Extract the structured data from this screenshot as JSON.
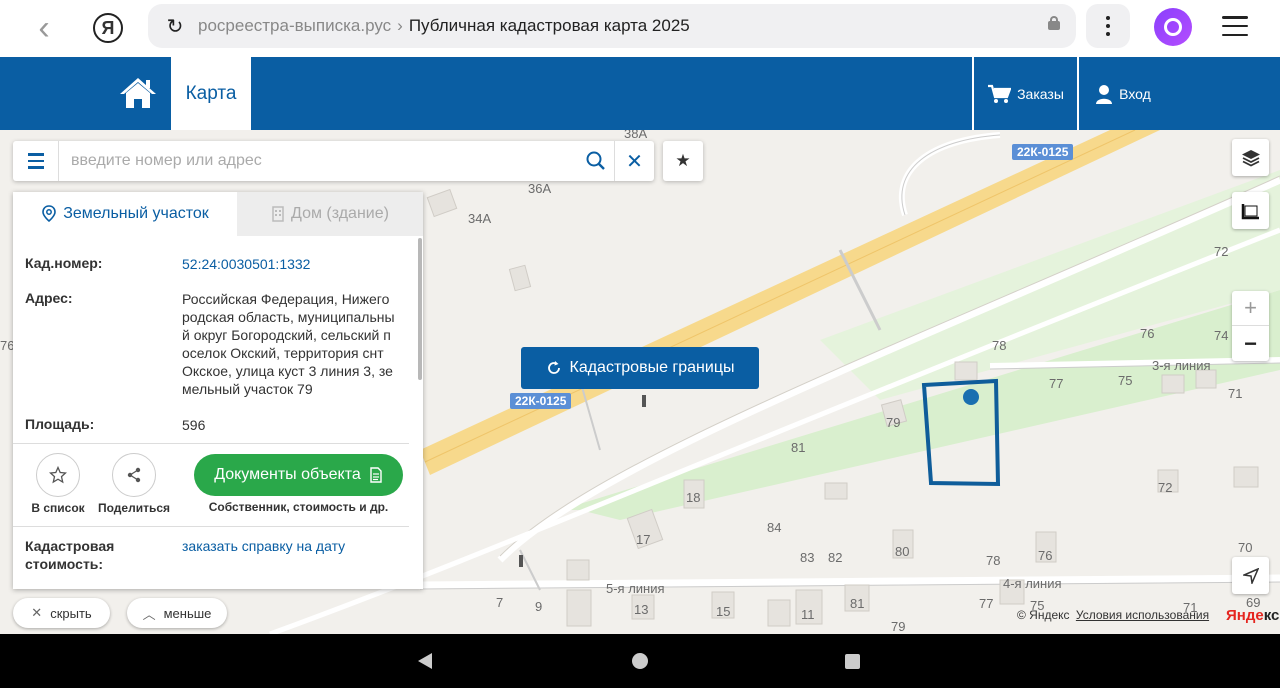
{
  "browser": {
    "domain": "росреестра-выписка.рус",
    "separator": "›",
    "page_title": "Публичная кадастровая карта 2025",
    "yandex_letter": "Я"
  },
  "header": {
    "tab_map": "Карта",
    "orders": "Заказы",
    "login": "Вход"
  },
  "search": {
    "placeholder": "введите номер или адрес"
  },
  "panel": {
    "tab_land": "Земельный участок",
    "tab_house": "Дом (здание)",
    "kad_label": "Кад.номер:",
    "kad_value": "52:24:0030501:1332",
    "address_label": "Адрес:",
    "address_value": "Российская Федерация, Нижего родская область, муниципальны й округ Богородский, сельский п оселок Окский, территория снт Окское, улица куст 3 линия 3, зе мельный участок 79",
    "area_label": "Площадь:",
    "area_value": "596",
    "add_to_list": "В список",
    "share": "Поделиться",
    "documents_button": "Документы объекта",
    "documents_sub": "Собственник, стоимость и др.",
    "cost_label": "Кадастровая стоимость:",
    "cost_link": "заказать справку на дату"
  },
  "map": {
    "cadastral_button": "Кадастровые границы",
    "road_badge": "22К-0125",
    "street_3": "3-я линия",
    "street_4": "4-я линия",
    "street_5": "5-я линия",
    "house_numbers": [
      "38А",
      "36А",
      "34А",
      "72",
      "76",
      "74",
      "78",
      "77",
      "75",
      "71",
      "79",
      "81",
      "72",
      "18",
      "84",
      "17",
      "83",
      "82",
      "80",
      "78",
      "76",
      "70",
      "69",
      "7",
      "9",
      "13",
      "15",
      "11",
      "81",
      "77",
      "75",
      "71",
      "79",
      "76"
    ],
    "highlight_color": "#0f5d9a",
    "road_color": "#f7d98c",
    "green_color": "#d9efce"
  },
  "controls": {
    "zoom_in": "+",
    "zoom_out": "−",
    "hide": "скрыть",
    "less": "меньше"
  },
  "footer": {
    "copyright": "© Яндекс",
    "terms": "Условия использования",
    "logo_main": "Янде",
    "logo_tail": "кс"
  }
}
